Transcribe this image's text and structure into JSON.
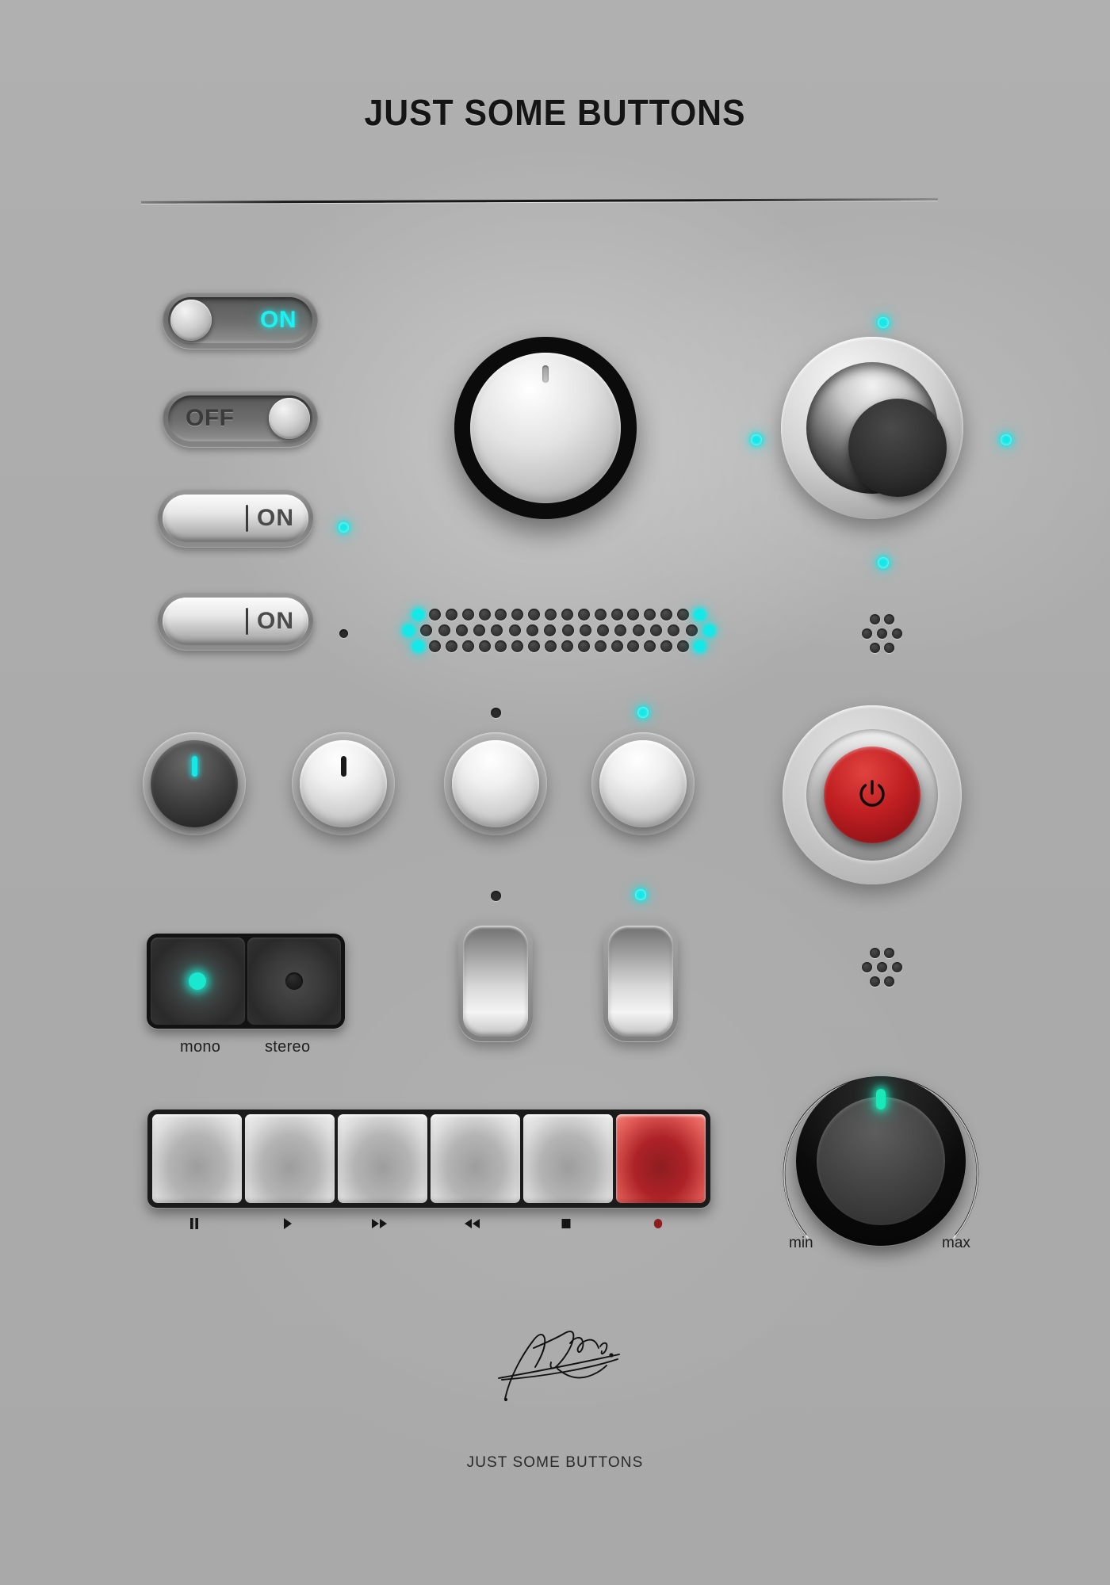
{
  "header": {
    "title": "JUST SOME BUTTONS"
  },
  "footer": {
    "caption": "JUST SOME BUTTONS",
    "signature_icon": "signature-scribble"
  },
  "colors": {
    "panel_bg": "#adadad",
    "led_cyan": "#16e8e8",
    "record_red": "#c01f22",
    "power_red": "#c01f22",
    "text_dark": "#151515"
  },
  "slide_toggles": [
    {
      "name": "toggle-on-dark",
      "label": "ON",
      "state": "on",
      "knob_side": "left",
      "label_side": "right",
      "lit": true
    },
    {
      "name": "toggle-off-dark",
      "label": "OFF",
      "state": "off",
      "knob_side": "right",
      "label_side": "left",
      "lit": false
    }
  ],
  "rocker_toggles": [
    {
      "name": "rocker-on-1",
      "label": "ON",
      "state": "on",
      "led": "on"
    },
    {
      "name": "rocker-on-2",
      "label": "ON",
      "state": "on",
      "led": "off"
    }
  ],
  "big_knob": {
    "name": "master-knob",
    "indicator_position": "top",
    "indicator": "notch"
  },
  "dome_button": {
    "name": "dome-button",
    "leds": [
      "top",
      "left",
      "right",
      "bottom"
    ],
    "led_state": "on"
  },
  "grille": {
    "name": "speaker-grille",
    "rows": 3,
    "dots_per_row": 19,
    "end_leds_lit": true
  },
  "clusters": [
    {
      "name": "dot-cluster-upper",
      "dots": 7
    },
    {
      "name": "dot-cluster-lower",
      "dots": 7
    }
  ],
  "small_knobs": [
    {
      "name": "knob-1",
      "style": "dark",
      "indicator": "cyan",
      "led": null
    },
    {
      "name": "knob-2",
      "style": "light",
      "indicator": "black",
      "led": null
    },
    {
      "name": "knob-3",
      "style": "light",
      "indicator": "none",
      "led": "off"
    },
    {
      "name": "knob-4",
      "style": "light",
      "indicator": "none",
      "led": "on"
    }
  ],
  "power_button": {
    "name": "power-button",
    "icon": "power-icon",
    "color": "#c01f22",
    "state": "on"
  },
  "mode_pad": {
    "name": "mono-stereo-pad",
    "options": [
      {
        "label": "mono",
        "selected": true
      },
      {
        "label": "stereo",
        "selected": false
      }
    ]
  },
  "tall_rockers": [
    {
      "name": "tall-rocker-1",
      "led": "off"
    },
    {
      "name": "tall-rocker-2",
      "led": "on"
    }
  ],
  "transport": {
    "name": "transport-bar",
    "buttons": [
      {
        "name": "pause-button",
        "icon": "pause-icon",
        "label": "pause",
        "style": "normal"
      },
      {
        "name": "play-button",
        "icon": "play-icon",
        "label": "play",
        "style": "normal"
      },
      {
        "name": "fast-forward-button",
        "icon": "fast-forward-icon",
        "label": "fast forward",
        "style": "normal"
      },
      {
        "name": "rewind-button",
        "icon": "rewind-icon",
        "label": "rewind",
        "style": "normal"
      },
      {
        "name": "stop-button",
        "icon": "stop-icon",
        "label": "stop",
        "style": "normal"
      },
      {
        "name": "record-button",
        "icon": "record-icon",
        "label": "record",
        "style": "record"
      }
    ]
  },
  "volume_knob": {
    "name": "volume-knob",
    "min_label": "min",
    "max_label": "max",
    "indicator": "cyan",
    "indicator_position": "top"
  }
}
